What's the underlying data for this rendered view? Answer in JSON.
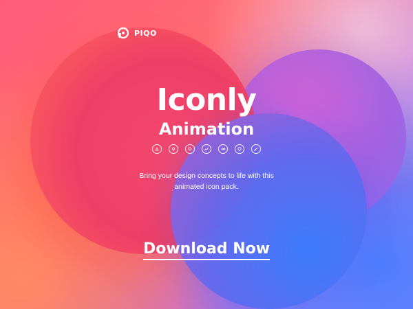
{
  "brand": {
    "name": "PIQO",
    "logo_icon": "piqo-logo-icon"
  },
  "hero": {
    "title": "Iconly",
    "subtitle": "Animation",
    "description_line1": "Bring your design concepts to life with this",
    "description_line2": "animated icon pack.",
    "cta_label": "Download Now"
  },
  "icons": [
    "compass-icon",
    "bulb-icon",
    "tag-icon",
    "chart-icon",
    "infinity-icon",
    "shield-icon",
    "brush-icon"
  ],
  "colors": {
    "background_pink": "#ff5c7a",
    "circle_red": "#ef3f66",
    "circle_purple": "#a45fe0",
    "circle_blue": "#3b7dff",
    "text": "#ffffff"
  }
}
